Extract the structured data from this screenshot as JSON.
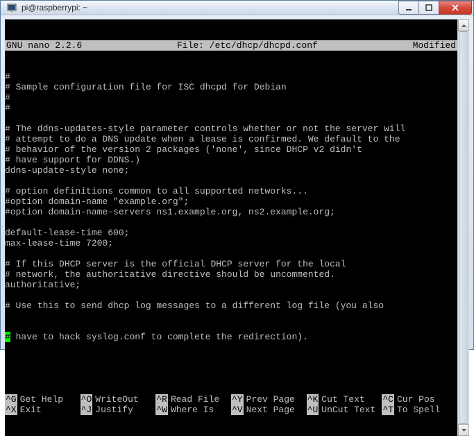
{
  "window": {
    "title": "pi@raspberrypi: ~"
  },
  "editor": {
    "app": "GNU nano 2.2.6",
    "file_label": "File: /etc/dhcp/dhcpd.conf",
    "status": "Modified"
  },
  "content_lines": [
    "#",
    "# Sample configuration file for ISC dhcpd for Debian",
    "#",
    "#",
    "",
    "# The ddns-updates-style parameter controls whether or not the server will",
    "# attempt to do a DNS update when a lease is confirmed. We default to the",
    "# behavior of the version 2 packages ('none', since DHCP v2 didn't",
    "# have support for DDNS.)",
    "ddns-update-style none;",
    "",
    "# option definitions common to all supported networks...",
    "#option domain-name \"example.org\";",
    "#option domain-name-servers ns1.example.org, ns2.example.org;",
    "",
    "default-lease-time 600;",
    "max-lease-time 7200;",
    "",
    "# If this DHCP server is the official DHCP server for the local",
    "# network, the authoritative directive should be uncommented.",
    "authoritative;",
    "",
    "# Use this to send dhcp log messages to a different log file (you also"
  ],
  "cursor_line": {
    "prefix": "#",
    "rest": " have to hack syslog.conf to complete the redirection)."
  },
  "shortcuts": [
    {
      "key": "^G",
      "label": "Get Help"
    },
    {
      "key": "^O",
      "label": "WriteOut"
    },
    {
      "key": "^R",
      "label": "Read File"
    },
    {
      "key": "^Y",
      "label": "Prev Page"
    },
    {
      "key": "^K",
      "label": "Cut Text"
    },
    {
      "key": "^C",
      "label": "Cur Pos"
    },
    {
      "key": "^X",
      "label": "Exit"
    },
    {
      "key": "^J",
      "label": "Justify"
    },
    {
      "key": "^W",
      "label": "Where Is"
    },
    {
      "key": "^V",
      "label": "Next Page"
    },
    {
      "key": "^U",
      "label": "UnCut Text"
    },
    {
      "key": "^T",
      "label": "To Spell"
    }
  ]
}
